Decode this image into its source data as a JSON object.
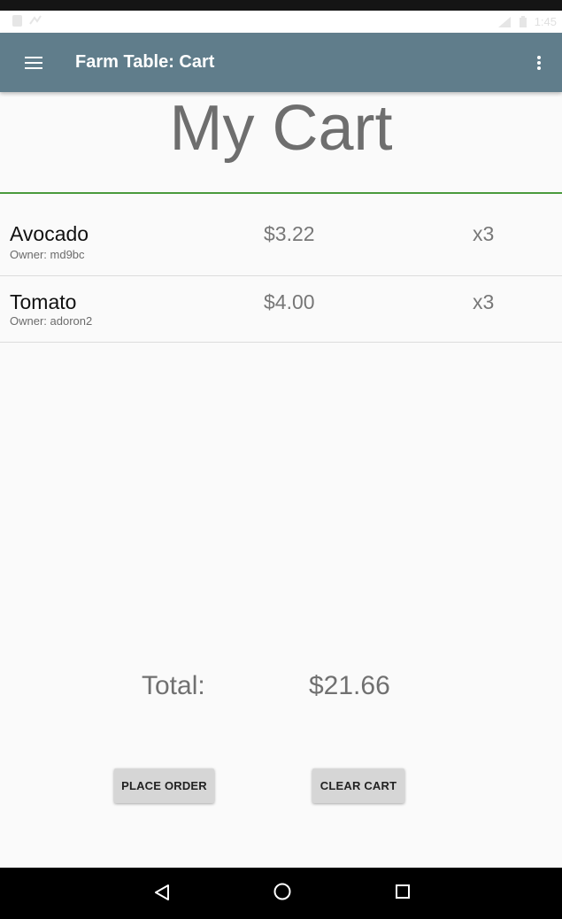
{
  "status_bar": {
    "time": "1:45"
  },
  "app_bar": {
    "title": "Farm Table: Cart",
    "menu_icon": "hamburger-menu-icon",
    "overflow_icon": "more-vertical-icon",
    "background_color": "#607d8b"
  },
  "page": {
    "title": "My Cart",
    "divider_color": "#4a9a3c"
  },
  "cart": {
    "items": [
      {
        "name": "Avocado",
        "owner": "Owner: md9bc",
        "price": "$3.22",
        "quantity": "x3"
      },
      {
        "name": "Tomato",
        "owner": "Owner: adoron2",
        "price": "$4.00",
        "quantity": "x3"
      }
    ]
  },
  "summary": {
    "total_label": "Total:",
    "total_value": "$21.66"
  },
  "actions": {
    "place_order": "PLACE ORDER",
    "clear_cart": "CLEAR CART"
  },
  "nav_bar": {
    "back_icon": "back-triangle-icon",
    "home_icon": "home-circle-icon",
    "recents_icon": "recents-square-icon"
  }
}
